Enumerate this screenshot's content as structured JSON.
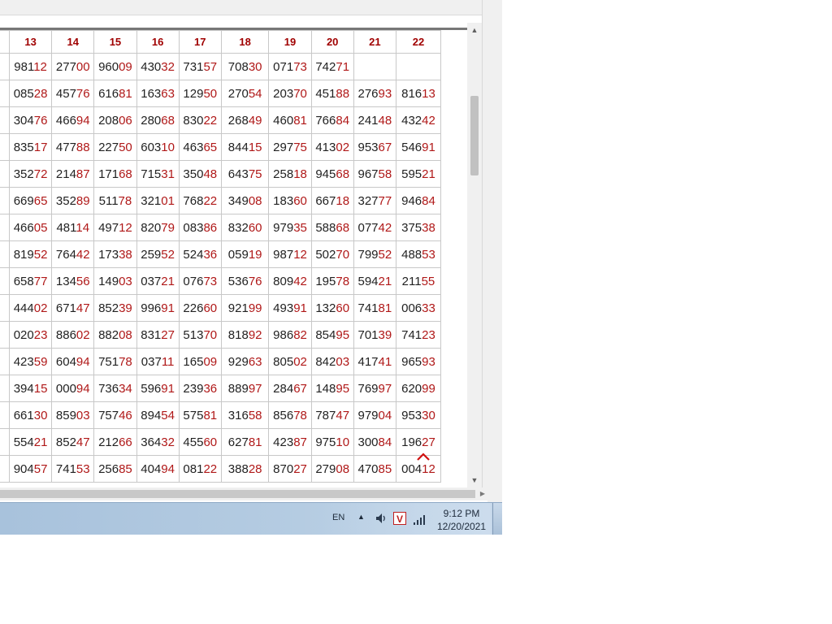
{
  "columns": [
    "13",
    "14",
    "15",
    "16",
    "17",
    "18",
    "19",
    "20",
    "21",
    "22"
  ],
  "rows": [
    {
      "cells": [
        [
          "981",
          "12"
        ],
        [
          "277",
          "00"
        ],
        [
          "960",
          "09"
        ],
        [
          "430",
          "32"
        ],
        [
          "731",
          "57"
        ],
        [
          "708",
          "30"
        ],
        [
          "071",
          "73"
        ],
        [
          "742",
          "71"
        ],
        [
          "",
          ""
        ],
        [
          "",
          ""
        ]
      ],
      "hl": [
        "",
        "",
        "",
        "",
        "",
        "orange",
        "orange",
        "orange",
        "orange",
        ""
      ]
    },
    {
      "cells": [
        [
          "085",
          "28"
        ],
        [
          "457",
          "76"
        ],
        [
          "616",
          "81"
        ],
        [
          "163",
          "63"
        ],
        [
          "129",
          "50"
        ],
        [
          "270",
          "54"
        ],
        [
          "203",
          "70"
        ],
        [
          "451",
          "88"
        ],
        [
          "276",
          "93"
        ],
        [
          "816",
          "13"
        ]
      ],
      "hl": [
        "green",
        "",
        "",
        "",
        "",
        "orange",
        "orange",
        "orange",
        "orange",
        ""
      ]
    },
    {
      "cells": [
        [
          "304",
          "76"
        ],
        [
          "466",
          "94"
        ],
        [
          "208",
          "06"
        ],
        [
          "280",
          "68"
        ],
        [
          "830",
          "22"
        ],
        [
          "268",
          "49"
        ],
        [
          "460",
          "81"
        ],
        [
          "766",
          "84"
        ],
        [
          "241",
          "48"
        ],
        [
          "432",
          "42"
        ]
      ],
      "hl": [
        "",
        "",
        "green",
        "",
        "",
        "",
        "",
        "",
        "",
        "green"
      ]
    },
    {
      "cells": [
        [
          "835",
          "17"
        ],
        [
          "477",
          "88"
        ],
        [
          "227",
          "50"
        ],
        [
          "603",
          "10"
        ],
        [
          "463",
          "65"
        ],
        [
          "844",
          "15"
        ],
        [
          "297",
          "75"
        ],
        [
          "413",
          "02"
        ],
        [
          "953",
          "67"
        ],
        [
          "546",
          "91"
        ]
      ],
      "hl": [
        "",
        "",
        "",
        "green",
        "",
        "",
        "",
        "",
        "",
        ""
      ]
    },
    {
      "cells": [
        [
          "352",
          "72"
        ],
        [
          "214",
          "87"
        ],
        [
          "171",
          "68"
        ],
        [
          "715",
          "31"
        ],
        [
          "350",
          "48"
        ],
        [
          "643",
          "75"
        ],
        [
          "258",
          "18"
        ],
        [
          "945",
          "68"
        ],
        [
          "967",
          "58"
        ],
        [
          "595",
          "21"
        ]
      ],
      "hl": [
        "",
        "",
        "",
        "",
        "green",
        "",
        "",
        "",
        "",
        ""
      ]
    },
    {
      "cells": [
        [
          "669",
          "65"
        ],
        [
          "352",
          "89"
        ],
        [
          "511",
          "78"
        ],
        [
          "321",
          "01"
        ],
        [
          "768",
          "22"
        ],
        [
          "349",
          "08"
        ],
        [
          "183",
          "60"
        ],
        [
          "667",
          "18"
        ],
        [
          "327",
          "77"
        ],
        [
          "946",
          "84"
        ]
      ],
      "hl": [
        "",
        "",
        "",
        "",
        "",
        "green",
        "",
        "",
        "",
        ""
      ]
    },
    {
      "cells": [
        [
          "466",
          "05"
        ],
        [
          "481",
          "14"
        ],
        [
          "497",
          "12"
        ],
        [
          "820",
          "79"
        ],
        [
          "083",
          "86"
        ],
        [
          "832",
          "60"
        ],
        [
          "979",
          "35"
        ],
        [
          "588",
          "68"
        ],
        [
          "077",
          "42"
        ],
        [
          "375",
          "38"
        ]
      ],
      "hl": [
        "green",
        "",
        "",
        "",
        "",
        "",
        "",
        "green",
        "",
        ""
      ]
    },
    {
      "cells": [
        [
          "819",
          "52"
        ],
        [
          "764",
          "42"
        ],
        [
          "173",
          "38"
        ],
        [
          "259",
          "52"
        ],
        [
          "524",
          "36"
        ],
        [
          "059",
          "19"
        ],
        [
          "987",
          "12"
        ],
        [
          "502",
          "70"
        ],
        [
          "799",
          "52"
        ],
        [
          "488",
          "53"
        ]
      ],
      "hl": [
        "",
        "green",
        "",
        "",
        "",
        "",
        "",
        "",
        "green",
        ""
      ]
    },
    {
      "cells": [
        [
          "658",
          "77"
        ],
        [
          "134",
          "56"
        ],
        [
          "149",
          "03"
        ],
        [
          "037",
          "21"
        ],
        [
          "076",
          "73"
        ],
        [
          "536",
          "76"
        ],
        [
          "809",
          "42"
        ],
        [
          "195",
          "78"
        ],
        [
          "594",
          "21"
        ],
        [
          "211",
          "55"
        ]
      ],
      "hl": [
        "",
        "",
        "green",
        "",
        "",
        "",
        "",
        "",
        "",
        "green"
      ]
    },
    {
      "cells": [
        [
          "444",
          "02"
        ],
        [
          "671",
          "47"
        ],
        [
          "852",
          "39"
        ],
        [
          "996",
          "91"
        ],
        [
          "226",
          "60"
        ],
        [
          "921",
          "99"
        ],
        [
          "493",
          "91"
        ],
        [
          "132",
          "60"
        ],
        [
          "741",
          "81"
        ],
        [
          "006",
          "33"
        ]
      ],
      "hl": [
        "",
        "",
        "",
        "green",
        "",
        "",
        "",
        "",
        "",
        ""
      ]
    },
    {
      "cells": [
        [
          "020",
          "23"
        ],
        [
          "886",
          "02"
        ],
        [
          "882",
          "08"
        ],
        [
          "831",
          "27"
        ],
        [
          "513",
          "70"
        ],
        [
          "818",
          "92"
        ],
        [
          "986",
          "82"
        ],
        [
          "854",
          "95"
        ],
        [
          "701",
          "39"
        ],
        [
          "741",
          "23"
        ]
      ],
      "hl": [
        "",
        "",
        "",
        "",
        "",
        "green",
        "",
        "",
        "",
        ""
      ]
    },
    {
      "cells": [
        [
          "423",
          "59"
        ],
        [
          "604",
          "94"
        ],
        [
          "751",
          "78"
        ],
        [
          "037",
          "11"
        ],
        [
          "165",
          "09"
        ],
        [
          "929",
          "63"
        ],
        [
          "805",
          "02"
        ],
        [
          "842",
          "03"
        ],
        [
          "417",
          "41"
        ],
        [
          "965",
          "93"
        ]
      ],
      "hl": [
        "",
        "",
        "",
        "",
        "",
        "yellow",
        "green",
        "",
        "",
        ""
      ]
    },
    {
      "cells": [
        [
          "394",
          "15"
        ],
        [
          "000",
          "94"
        ],
        [
          "736",
          "34"
        ],
        [
          "596",
          "91"
        ],
        [
          "239",
          "36"
        ],
        [
          "889",
          "97"
        ],
        [
          "284",
          "67"
        ],
        [
          "148",
          "95"
        ],
        [
          "769",
          "97"
        ],
        [
          "620",
          "99"
        ]
      ],
      "hl": [
        "green",
        "",
        "",
        "",
        "",
        "",
        "",
        "green",
        "",
        ""
      ]
    },
    {
      "cells": [
        [
          "661",
          "30"
        ],
        [
          "859",
          "03"
        ],
        [
          "757",
          "46"
        ],
        [
          "894",
          "54"
        ],
        [
          "575",
          "81"
        ],
        [
          "316",
          "58"
        ],
        [
          "856",
          "78"
        ],
        [
          "787",
          "47"
        ],
        [
          "979",
          "04"
        ],
        [
          "953",
          "30"
        ]
      ],
      "hl": [
        "",
        "green",
        "",
        "",
        "",
        "",
        "",
        "",
        "green",
        ""
      ]
    },
    {
      "cells": [
        [
          "554",
          "21"
        ],
        [
          "852",
          "47"
        ],
        [
          "212",
          "66"
        ],
        [
          "364",
          "32"
        ],
        [
          "455",
          "60"
        ],
        [
          "627",
          "81"
        ],
        [
          "423",
          "87"
        ],
        [
          "975",
          "10"
        ],
        [
          "300",
          "84"
        ],
        [
          "196",
          "27"
        ]
      ],
      "hl": [
        "",
        "",
        "",
        "green",
        "",
        "",
        "",
        "",
        "",
        ""
      ]
    },
    {
      "cells": [
        [
          "904",
          "57"
        ],
        [
          "741",
          "53"
        ],
        [
          "256",
          "85"
        ],
        [
          "404",
          "94"
        ],
        [
          "081",
          "22"
        ],
        [
          "388",
          "28"
        ],
        [
          "870",
          "27"
        ],
        [
          "279",
          "08"
        ],
        [
          "470",
          "85"
        ],
        [
          "004",
          "12"
        ]
      ],
      "hl": [
        "",
        "",
        "",
        "",
        "green",
        "",
        "",
        "",
        "",
        ""
      ]
    }
  ],
  "taskbar": {
    "lang": "EN",
    "time": "9:12 PM",
    "date": "12/20/2021"
  },
  "colors": {
    "orange": "#ffb400",
    "green": "#e3f1de",
    "yellow": "#fde8a8",
    "header_text": "#a00000"
  },
  "icons": [
    "scroll-up-arrow-icon",
    "scroll-down-arrow-icon",
    "scroll-right-arrow-icon",
    "tray-expand-icon",
    "volume-icon",
    "v-app-icon",
    "network-signal-icon",
    "scroll-top-caret-icon"
  ]
}
